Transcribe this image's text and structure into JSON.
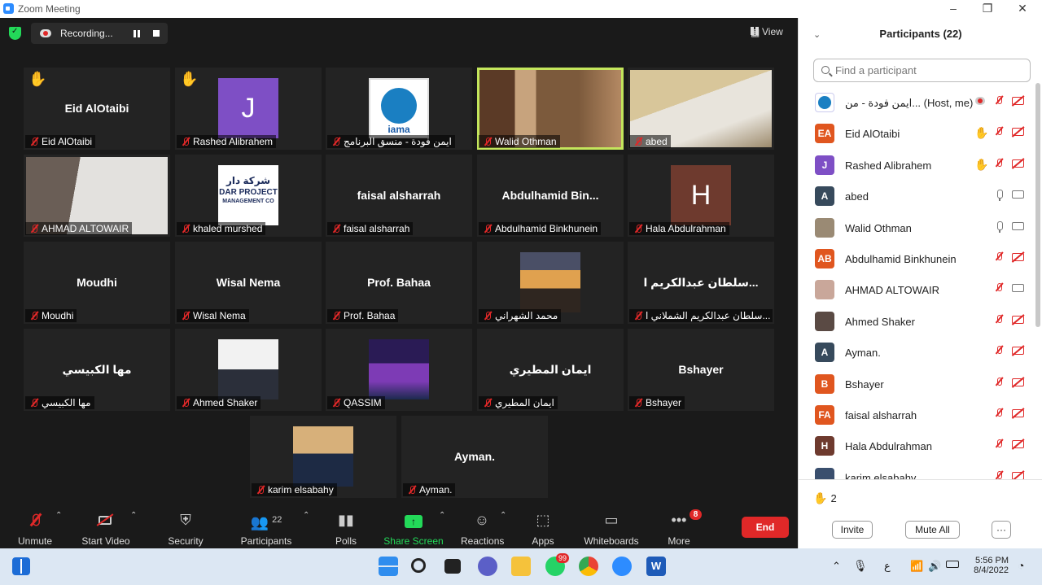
{
  "window": {
    "title": "Zoom Meeting"
  },
  "top": {
    "recording_label": "Recording...",
    "view_label": "View"
  },
  "tiles": [
    {
      "name": "Eid AlOtaibi",
      "label": "Eid AlOtaibi",
      "hand": true
    },
    {
      "name": "",
      "label": "Rashed Alibrahem",
      "hand": true,
      "avatar_letter": "J",
      "avatar_color": "#7e4fc5"
    },
    {
      "name": "",
      "label": "ايمن فودة - منسق البرنامج",
      "image": "iama-logo"
    },
    {
      "name": "",
      "label": "Walid Othman",
      "image": "video-walid",
      "speaking": true
    },
    {
      "name": "",
      "label": "abed",
      "image": "video-abed"
    },
    {
      "name": "",
      "label": "AHMAD ALTOWAIR",
      "image": "video-ahmad"
    },
    {
      "name": "",
      "label": "khaled murshed",
      "image": "dar-project-logo",
      "logo_line1": "شركة دار",
      "logo_line2": "DAR PROJECT",
      "logo_line3": "MANAGEMENT CO"
    },
    {
      "name": "faisal alsharrah",
      "label": "faisal alsharrah"
    },
    {
      "name": "Abdulhamid  Bin...",
      "label": "Abdulhamid Binkhunein"
    },
    {
      "name": "",
      "label": "Hala Abdulrahman",
      "avatar_letter": "H",
      "avatar_color": "#6e3a2e"
    },
    {
      "name": "Moudhi",
      "label": "Moudhi"
    },
    {
      "name": "Wisal Nema",
      "label": "Wisal Nema"
    },
    {
      "name": "Prof. Bahaa",
      "label": "Prof. Bahaa"
    },
    {
      "name": "",
      "label": "محمد الشهراني",
      "image": "sunset-photo"
    },
    {
      "name": "سلطان عبدالكريم ا...",
      "label": "سلطان عبدالكريم الشملاني ا..."
    },
    {
      "name": "مها الكبيسي",
      "label": "مها الكبيسي"
    },
    {
      "name": "",
      "label": "Ahmed Shaker",
      "image": "portrait-photo"
    },
    {
      "name": "",
      "label": "QASSIM",
      "image": "city-night-photo"
    },
    {
      "name": "ايمان المطيري",
      "label": "ايمان المطيري"
    },
    {
      "name": "Bshayer",
      "label": "Bshayer"
    },
    {
      "name": "",
      "label": "karim elsabahy",
      "image": "office-photo"
    },
    {
      "name": "Ayman.",
      "label": "Ayman."
    }
  ],
  "toolbar": {
    "unmute": "Unmute",
    "start_video": "Start Video",
    "security": "Security",
    "participants": "Participants",
    "participants_count": "22",
    "polls": "Polls",
    "share_screen": "Share Screen",
    "reactions": "Reactions",
    "apps": "Apps",
    "whiteboards": "Whiteboards",
    "more": "More",
    "more_badge": "8",
    "end": "End"
  },
  "panel": {
    "title": "Participants (22)",
    "search_placeholder": "Find a participant",
    "participants": [
      {
        "name": "ايمن فودة - من...",
        "suffix": "(Host, me)",
        "avatar": "",
        "color": "#ffffff",
        "mic": "muted",
        "video": "off",
        "host": true
      },
      {
        "name": "Eid AlOtaibi",
        "avatar": "EA",
        "color": "#e0561f",
        "hand": true,
        "mic": "muted",
        "video": "off"
      },
      {
        "name": "Rashed Alibrahem",
        "avatar": "J",
        "color": "#7e4fc5",
        "hand": true,
        "mic": "muted",
        "video": "off"
      },
      {
        "name": "abed",
        "avatar": "A",
        "color": "#374a5c",
        "mic": "on",
        "video": "on"
      },
      {
        "name": "Walid Othman",
        "avatar": "",
        "color": "#9a8a74",
        "mic": "on",
        "video": "on"
      },
      {
        "name": "Abdulhamid Binkhunein",
        "avatar": "AB",
        "color": "#e0561f",
        "mic": "muted",
        "video": "off"
      },
      {
        "name": "AHMAD ALTOWAIR",
        "avatar": "",
        "color": "#c9a79a",
        "mic": "muted",
        "video": "on"
      },
      {
        "name": "Ahmed Shaker",
        "avatar": "",
        "color": "#5a4a44",
        "mic": "muted",
        "video": "off"
      },
      {
        "name": "Ayman.",
        "avatar": "A",
        "color": "#374a5c",
        "mic": "muted",
        "video": "off"
      },
      {
        "name": "Bshayer",
        "avatar": "B",
        "color": "#e0561f",
        "mic": "muted",
        "video": "off"
      },
      {
        "name": "faisal alsharrah",
        "avatar": "FA",
        "color": "#e0561f",
        "mic": "muted",
        "video": "off"
      },
      {
        "name": "Hala Abdulrahman",
        "avatar": "H",
        "color": "#6e3a2e",
        "mic": "muted",
        "video": "off"
      },
      {
        "name": "karim elsabahy",
        "avatar": "",
        "color": "#3a4f6e",
        "mic": "muted",
        "video": "off"
      }
    ],
    "raised_hands": "2",
    "invite": "Invite",
    "mute_all": "Mute All",
    "more": "···"
  },
  "taskbar": {
    "time": "5:56 PM",
    "date": "8/4/2022",
    "lang": "ع",
    "whatsapp_badge": "99"
  }
}
